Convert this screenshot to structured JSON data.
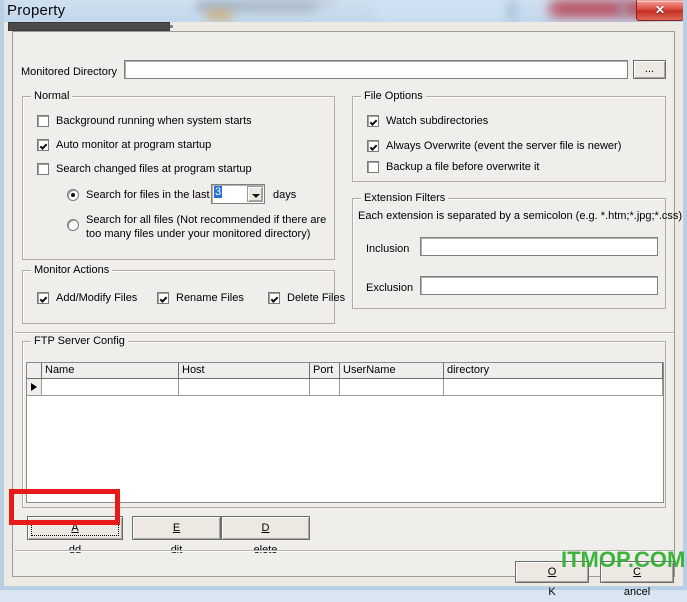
{
  "window": {
    "title": "Property",
    "close_icon": "close-x-icon",
    "close_label": "✕"
  },
  "monitored": {
    "label": "Monitored Directory",
    "value": "",
    "placeholder": "",
    "browse_label": "..."
  },
  "normal": {
    "title": "Normal",
    "checkboxes": [
      {
        "label": "Background running when system starts",
        "checked": false
      },
      {
        "label": "Auto monitor at program startup",
        "checked": true
      },
      {
        "label": "Search  changed files at program startup",
        "checked": false
      }
    ],
    "radios": [
      {
        "label": "Search for files in the last",
        "selected": true
      },
      {
        "label": "Search for all files (Not recommended if there are",
        "label2": "too many files under your monitored directory)",
        "selected": false
      }
    ],
    "days_value": "3",
    "days_label": "days"
  },
  "file_options": {
    "title": "File Options",
    "checkboxes": [
      {
        "label": "Watch subdirectories",
        "checked": true
      },
      {
        "label": "Always Overwrite (event the server file is newer)",
        "checked": true
      },
      {
        "label": "Backup a file before overwrite it",
        "checked": false
      }
    ]
  },
  "extension_filters": {
    "title": "Extension Filters",
    "hint": "Each extension is separated by a semicolon (e.g. *.htm;*.jpg;*.css)",
    "inclusion_label": "Inclusion",
    "inclusion_value": "",
    "exclusion_label": "Exclusion",
    "exclusion_value": ""
  },
  "monitor_actions": {
    "title": "Monitor Actions",
    "checkboxes": [
      {
        "label": "Add/Modify  Files",
        "checked": true
      },
      {
        "label": "Rename Files",
        "checked": true
      },
      {
        "label": "Delete Files",
        "checked": true
      }
    ]
  },
  "ftp": {
    "title": "FTP Server Config",
    "columns": [
      "Name",
      "Host",
      "Port",
      "UserName",
      "directory"
    ],
    "rows": [
      {
        "Name": "",
        "Host": "",
        "Port": "",
        "UserName": "",
        "directory": ""
      }
    ]
  },
  "buttons": {
    "add": {
      "accel": "A",
      "rest": "dd",
      "focused": true,
      "highlighted": true
    },
    "edit": {
      "accel": "E",
      "rest": "dit"
    },
    "delete": {
      "accel": "D",
      "rest": "elete"
    },
    "ok": {
      "accel": "O",
      "rest": "K"
    },
    "cancel": {
      "accel": "C",
      "rest": "ancel"
    }
  },
  "watermark": {
    "text": "ITMOP.COM",
    "color": "#2fae2f"
  },
  "colors": {
    "dialog_face": "#f0eeea",
    "client_face": "#eceae3",
    "frame": "#b9cfe4",
    "accent_select": "#2a6fd4",
    "annotation_red": "#e81919"
  }
}
